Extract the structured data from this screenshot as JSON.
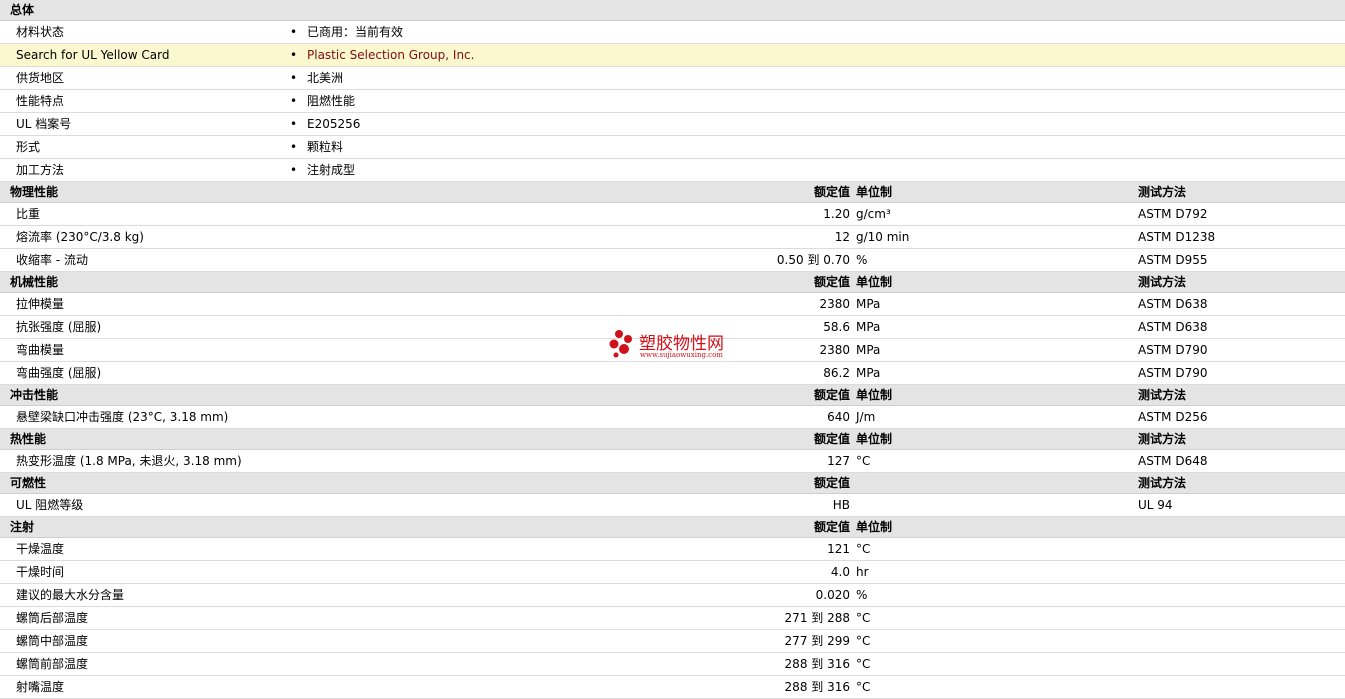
{
  "sections": [
    {
      "title": "总体",
      "kind": "general",
      "rows": [
        {
          "label": "材料状态",
          "value": "已商用：当前有效",
          "highlight": false,
          "link": false
        },
        {
          "label": "Search for UL Yellow Card",
          "value": "Plastic Selection Group, Inc.",
          "highlight": true,
          "link": true
        },
        {
          "label": "供货地区",
          "value": "北美洲",
          "highlight": false,
          "link": false
        },
        {
          "label": "性能特点",
          "value": "阻燃性能",
          "highlight": false,
          "link": false
        },
        {
          "label": "UL 档案号",
          "value": "E205256",
          "highlight": false,
          "link": false
        },
        {
          "label": "形式",
          "value": "颗粒料",
          "highlight": false,
          "link": false
        },
        {
          "label": "加工方法",
          "value": "注射成型",
          "highlight": false,
          "link": false
        }
      ]
    },
    {
      "title": "物理性能",
      "kind": "table",
      "col_value": "额定值",
      "col_unit": "单位制",
      "col_test": "测试方法",
      "rows": [
        {
          "label": "比重",
          "value": "1.20",
          "unit": "g/cm³",
          "test": "ASTM D792"
        },
        {
          "label": "熔流率  (230°C/3.8 kg)",
          "value": "12",
          "unit": "g/10 min",
          "test": "ASTM D1238"
        },
        {
          "label": "收缩率  - 流动",
          "value": "0.50 到  0.70",
          "unit": "%",
          "test": "ASTM D955"
        }
      ]
    },
    {
      "title": "机械性能",
      "kind": "table",
      "col_value": "额定值",
      "col_unit": "单位制",
      "col_test": "测试方法",
      "rows": [
        {
          "label": "拉伸模量",
          "value": "2380",
          "unit": "MPa",
          "test": "ASTM D638"
        },
        {
          "label": "抗张强度  (屈服)",
          "value": "58.6",
          "unit": "MPa",
          "test": "ASTM D638"
        },
        {
          "label": "弯曲模量",
          "value": "2380",
          "unit": "MPa",
          "test": "ASTM D790"
        },
        {
          "label": "弯曲强度  (屈服)",
          "value": "86.2",
          "unit": "MPa",
          "test": "ASTM D790"
        }
      ]
    },
    {
      "title": "冲击性能",
      "kind": "table",
      "col_value": "额定值",
      "col_unit": "单位制",
      "col_test": "测试方法",
      "rows": [
        {
          "label": "悬壁梁缺口冲击强度  (23°C, 3.18 mm)",
          "value": "640",
          "unit": "J/m",
          "test": "ASTM D256"
        }
      ]
    },
    {
      "title": "热性能",
      "kind": "table",
      "col_value": "额定值",
      "col_unit": "单位制",
      "col_test": "测试方法",
      "rows": [
        {
          "label": "热变形温度  (1.8 MPa, 未退火, 3.18 mm)",
          "value": "127",
          "unit": "°C",
          "test": "ASTM D648"
        }
      ]
    },
    {
      "title": "可燃性",
      "kind": "table",
      "col_value": "额定值",
      "col_unit": "",
      "col_test": "测试方法",
      "rows": [
        {
          "label": "UL 阻燃等级",
          "value": "HB",
          "unit": "",
          "test": "UL 94"
        }
      ]
    },
    {
      "title": "注射",
      "kind": "table",
      "col_value": "额定值",
      "col_unit": "单位制",
      "col_test": "",
      "rows": [
        {
          "label": "干燥温度",
          "value": "121",
          "unit": "°C",
          "test": ""
        },
        {
          "label": "干燥时间",
          "value": "4.0",
          "unit": "hr",
          "test": ""
        },
        {
          "label": "建议的最大水分含量",
          "value": "0.020",
          "unit": "%",
          "test": ""
        },
        {
          "label": "螺筒后部温度",
          "value": "271 到  288",
          "unit": "°C",
          "test": ""
        },
        {
          "label": "螺筒中部温度",
          "value": "277 到  299",
          "unit": "°C",
          "test": ""
        },
        {
          "label": "螺筒前部温度",
          "value": "288 到  316",
          "unit": "°C",
          "test": ""
        },
        {
          "label": "射嘴温度",
          "value": "288 到  316",
          "unit": "°C",
          "test": ""
        }
      ]
    }
  ],
  "bullet": "•",
  "watermark": {
    "name": "塑胶物性网",
    "url": "www.sujiaowuxing.com",
    "color": "#d0101a"
  }
}
